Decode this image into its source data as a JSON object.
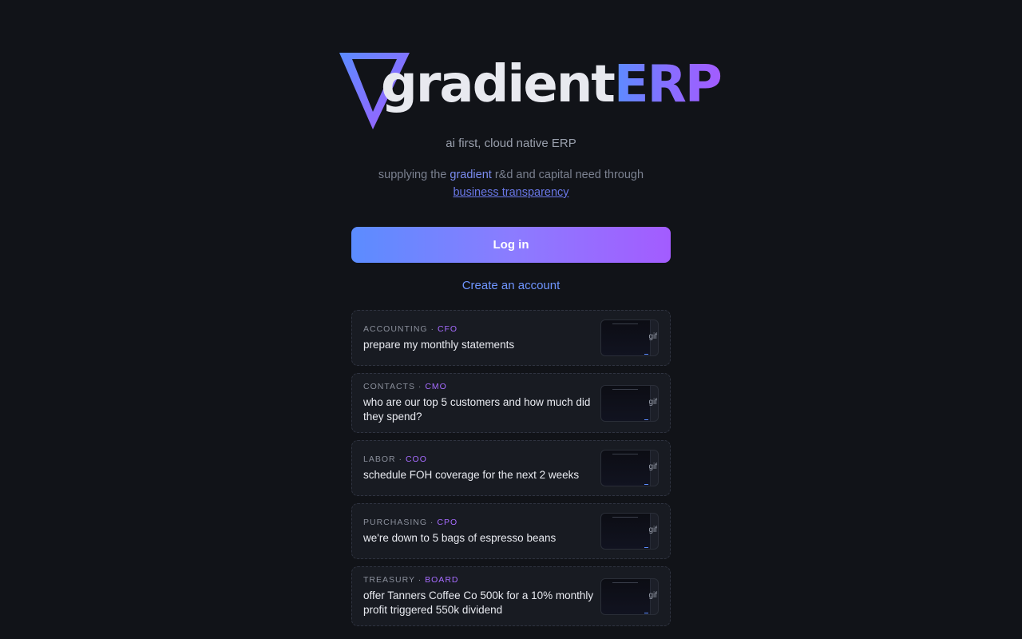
{
  "brand": {
    "name_part1": "gradient",
    "name_part2": "ERP",
    "logo_icon": "triangle-logo-icon",
    "accent_start": "#5b8cff",
    "accent_end": "#a35cff"
  },
  "tagline": "ai first, cloud native ERP",
  "mission": {
    "prefix": "supplying the",
    "highlight": "gradient",
    "middle": "r&d and capital need through",
    "link_text": "business transparency"
  },
  "auth": {
    "login_label": "Log in",
    "create_account_label": "Create an account"
  },
  "cards": [
    {
      "category": "ACCOUNTING",
      "separator": " · ",
      "role": "CFO",
      "prompt": "prepare my monthly statements",
      "thumb_label": "gif"
    },
    {
      "category": "CONTACTS",
      "separator": " · ",
      "role": "CMO",
      "prompt": "who are our top 5 customers and how much did they spend?",
      "thumb_label": "gif"
    },
    {
      "category": "LABOR",
      "separator": " · ",
      "role": "COO",
      "prompt": "schedule FOH coverage for the next 2 weeks",
      "thumb_label": "gif"
    },
    {
      "category": "PURCHASING",
      "separator": " · ",
      "role": "CPO",
      "prompt": "we're down to 5 bags of espresso beans",
      "thumb_label": "gif"
    },
    {
      "category": "TREASURY",
      "separator": " · ",
      "role": "BOARD",
      "prompt": "offer Tanners Coffee Co 500k for a 10% monthly profit triggered 550k dividend",
      "thumb_label": "gif"
    }
  ]
}
